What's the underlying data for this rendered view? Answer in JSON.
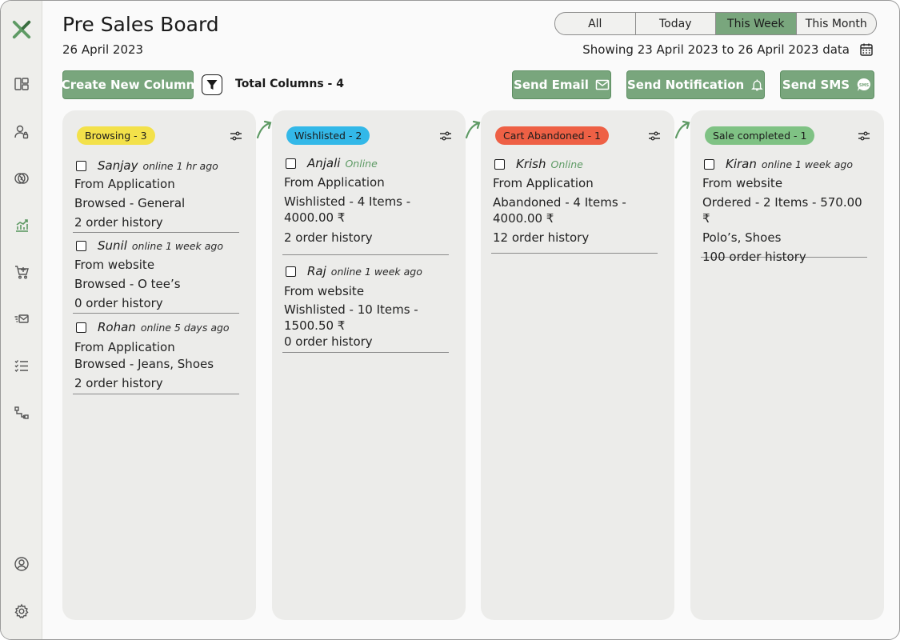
{
  "page": {
    "title": "Pre Sales Board",
    "date": "26 April 2023",
    "range_text": "Showing 23 April 2023 to 26 April 2023 data"
  },
  "filters": {
    "items": [
      "All",
      "Today",
      "This Week",
      "This Month"
    ],
    "selected": "This Week"
  },
  "toolbar": {
    "create_label": "Create New Column",
    "total_columns": "Total Columns - 4",
    "send_email": "Send Email",
    "send_notification": "Send Notification",
    "send_sms": "Send SMS"
  },
  "colors": {
    "accent": "#79a67d",
    "browsing": "#f3e14a",
    "wishlisted": "#33b8e8",
    "cart_abandoned": "#ee6045",
    "sale_completed": "#7fc284"
  },
  "sidebar": {
    "icons": [
      "logo-icon",
      "dashboard-icon",
      "user-lock-icon",
      "segments-icon",
      "analytics-icon",
      "cart-icon",
      "email-icon",
      "checklist-icon",
      "flow-icon",
      "profile-icon",
      "settings-icon"
    ]
  },
  "columns": [
    {
      "badge": "Browsing - 3",
      "cards": [
        {
          "name": "Sanjay",
          "status": "online 1 hr ago",
          "lines": [
            "From Application",
            "Browsed - General",
            "2 order history"
          ]
        },
        {
          "name": "Sunil",
          "status": "online 1 week ago",
          "lines": [
            "From website",
            "Browsed - O tee’s",
            "0 order history"
          ]
        },
        {
          "name": "Rohan",
          "status": "online 5 days ago",
          "lines": [
            "From Application",
            "Browsed - Jeans, Shoes",
            "2 order history"
          ]
        }
      ]
    },
    {
      "badge": "Wishlisted - 2",
      "cards": [
        {
          "name": "Anjali",
          "status": "Online",
          "lines": [
            "From Application",
            "Wishlisted - 4 Items -",
            "4000.00 ₹",
            "2 order history"
          ]
        },
        {
          "name": "Raj",
          "status": "online 1 week ago",
          "lines": [
            "From website",
            "Wishlisted - 10 Items -",
            "1500.50 ₹",
            "0 order history"
          ]
        }
      ]
    },
    {
      "badge": "Cart Abandoned - 1",
      "cards": [
        {
          "name": "Krish",
          "status": "Online",
          "lines": [
            "From Application",
            "Abandoned - 4 Items -",
            "4000.00 ₹",
            "12 order history"
          ]
        }
      ]
    },
    {
      "badge": "Sale completed - 1",
      "cards": [
        {
          "name": "Kiran",
          "status": "online 1 week ago",
          "lines": [
            "From website",
            "Ordered - 2 Items - 570.00 ₹",
            "Polo’s, Shoes",
            "100 order history"
          ]
        }
      ]
    }
  ]
}
